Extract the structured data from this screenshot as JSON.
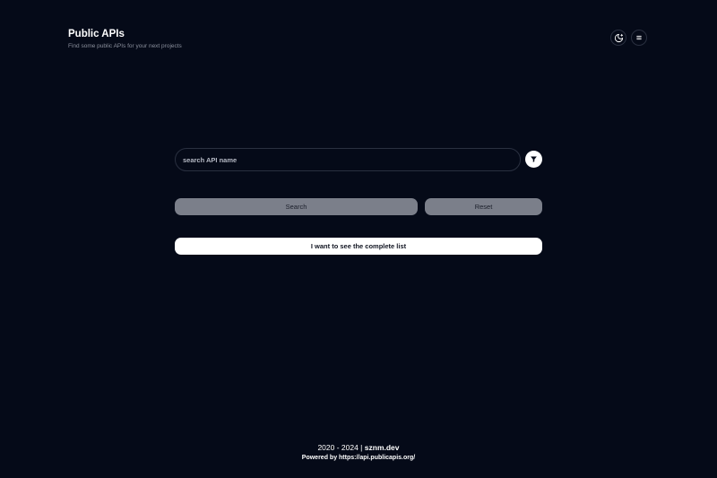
{
  "header": {
    "title": "Public APIs",
    "subtitle": "Find some public APIs for your next projects"
  },
  "header_actions": {
    "theme_icon": "moon-star-icon",
    "menu_icon": "menu-icon"
  },
  "search": {
    "placeholder": "search API name",
    "value": "",
    "filter_icon": "filter-icon"
  },
  "buttons": {
    "search_label": "Search",
    "reset_label": "Reset",
    "complete_list_label": "I want to see the complete list"
  },
  "footer": {
    "years": "2020 - 2024 |",
    "brand": "sznm.dev",
    "powered": "Powered by https://api.publicapis.org/"
  },
  "colors": {
    "background": "#050a18",
    "disabled_button": "#7b7f8a",
    "primary_button": "#ffffff"
  }
}
